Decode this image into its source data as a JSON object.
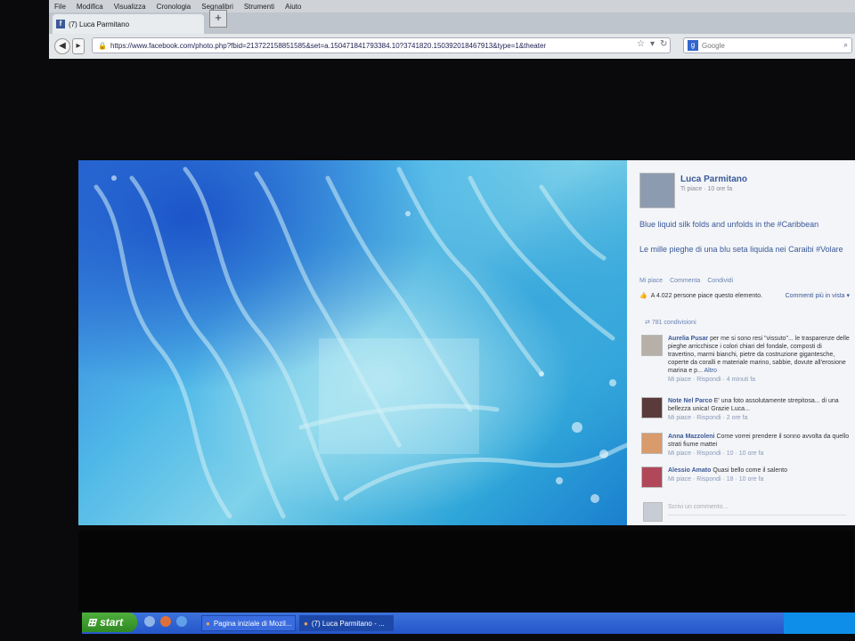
{
  "browser": {
    "menu": [
      "File",
      "Modifica",
      "Visualizza",
      "Cronologia",
      "Segnalibri",
      "Strumenti",
      "Aiuto"
    ],
    "tab_title": "(7) Luca Parmitano",
    "new_tab": "+",
    "url": "https://www.facebook.com/photo.php?fbid=213722158851585&set=a.150471841793384.10?3741820.150392018467913&type=1&theater",
    "search_engine": "Google",
    "search_placeholder": "Google"
  },
  "post": {
    "author": "Luca Parmitano",
    "meta": "Ti piace · 10 ore fa",
    "caption_en": "Blue liquid silk folds and unfolds in the #Caribbean",
    "caption_it": "Le mille pieghe di una blu seta liquida nei Caraibi #Volare",
    "actions": [
      "Mi piace",
      "Commenta",
      "Condividi"
    ],
    "likes_text": "A 4.022 persone piace questo elemento.",
    "more_comments": "Commenti più in vista ▾",
    "shares": "781 condivisioni"
  },
  "comments": [
    {
      "name": "Aurelia Pusar",
      "text": "per me si sono resi \"vissuto\"... le trasparenze delle pieghe arricchisce i colori chiari del fondale, composti di travertino, marmi bianchi, pietre da costruzione gigantesche, coperte da coralli e materiale marino, sabbie, dovute all'erosione marina e p...",
      "more": "Altro",
      "links": "Mi piace · Rispondi · 4 minuti fa"
    },
    {
      "name": "Note Nel Parco",
      "text": "E' una foto assolutamente strepitosa... di una bellezza unica! Grazie Luca...",
      "more": "",
      "links": "Mi piace · Rispondi · 2 ore fa"
    },
    {
      "name": "Anna Mazzoleni",
      "text": "Come vorrei prendere il sonno avvolta da quello strati fiume mattei",
      "more": "",
      "links": "Mi piace · Rispondi · 10 · 10 ore fa"
    },
    {
      "name": "Alessio Amato",
      "text": "Quasi bello come il salento",
      "more": "",
      "links": "Mi piace · Rispondi · 18 · 10 ore fa"
    }
  ],
  "comment_input_placeholder": "Scrivi un commento...",
  "taskbar": {
    "start": "start",
    "tasks": [
      "Pagina iniziale di Mozil...",
      "(7) Luca Parmitano - ..."
    ]
  },
  "colors": {
    "facebook_blue": "#3b5998",
    "link": "#6d84b4",
    "ocean_deep": "#1c55c9",
    "ocean_light": "#a8e3f0"
  },
  "icons": [
    "facebook-favicon",
    "back-icon",
    "forward-icon",
    "lock-icon",
    "bookmark-star-icon",
    "reload-icon",
    "google-icon",
    "search-icon",
    "like-icon",
    "share-icon",
    "windows-logo-icon",
    "firefox-icon"
  ]
}
